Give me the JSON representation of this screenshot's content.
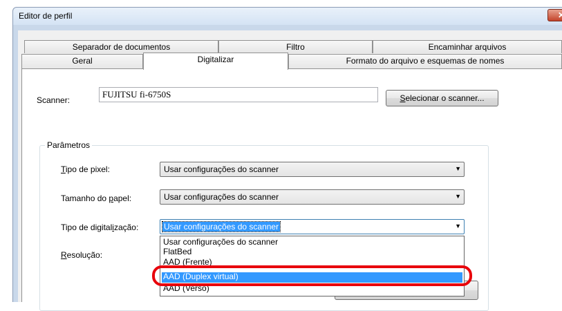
{
  "window": {
    "title": "Editor de perfil",
    "close_glyph": "✕"
  },
  "tabs": {
    "back_row": [
      {
        "label": "Separador de documentos"
      },
      {
        "label": "Filtro"
      },
      {
        "label": "Encaminhar arquivos"
      }
    ],
    "front_row": [
      {
        "label": "Geral"
      },
      {
        "label": "Digitalizar",
        "active": true
      },
      {
        "label": "Formato do arquivo e esquemas de nomes"
      }
    ]
  },
  "scanner": {
    "label": "Scanner:",
    "value": "FUJITSU fi-6750S",
    "select_button": {
      "pre": "",
      "mnemonic": "S",
      "post": "elecionar o scanner..."
    }
  },
  "parameters": {
    "group_title": "Parâmetros",
    "pixel_type": {
      "mnemonic": "T",
      "label_rest": "ipo de pixel:",
      "value": "Usar configurações do scanner"
    },
    "paper_size": {
      "label_pre": "Tamanho do ",
      "mnemonic": "p",
      "label_post": "apel:",
      "value": "Usar configurações do scanner"
    },
    "scan_type": {
      "label_pre": "Tipo de digital",
      "mnemonic": "i",
      "label_post": "zação:",
      "value": "Usar configurações do scanner"
    },
    "resolution": {
      "mnemonic": "R",
      "label_rest": "esolução:"
    }
  },
  "dropdown_options": [
    "Usar configurações do scanner",
    "FlatBed",
    "AAD (Frente)",
    "AAD (Duplex virtual)",
    "AAD (Verso)"
  ],
  "selected_option_index": 3,
  "colors": {
    "highlight": "#3399ff",
    "callout_ring": "#e8000b"
  }
}
